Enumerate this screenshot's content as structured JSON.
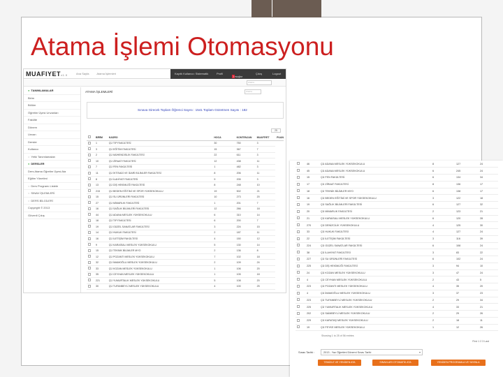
{
  "slide": {
    "title": "Atama İşlemi Otomasyonu"
  },
  "colors": {
    "title": "#cc1f1f",
    "accent_bar": "#6b5c52",
    "button": "#e8701b",
    "stats_text": "#2e3fb8"
  },
  "app": {
    "logo": "MUAFIYET",
    "logo_sub": "v1.0",
    "top_nav": [
      "Ana Sayfa",
      "Atama İşlemleri"
    ],
    "user_bar": [
      "Kayıtlı Kullanıcı: Sistematik",
      "Profil",
      "Mesajlar",
      "Çıkış",
      "Logout"
    ],
    "message_count": "3",
    "search_placeholder": "Arama"
  },
  "sidebar": {
    "items": [
      {
        "label": "TANIMLAMALAR",
        "type": "head"
      },
      {
        "label": "Birim",
        "type": "item"
      },
      {
        "label": "Bölüm",
        "type": "item"
      },
      {
        "label": "Öğretim Üyesi Unvanları",
        "type": "item"
      },
      {
        "label": "Fakülte",
        "type": "item"
      },
      {
        "label": "Dönem",
        "type": "item"
      },
      {
        "label": "Unvan",
        "type": "item"
      },
      {
        "label": "Dersler",
        "type": "item"
      },
      {
        "label": "Kullanıcı",
        "type": "item"
      },
      {
        "label": "Yetki Tanımlamaları",
        "type": "sub"
      },
      {
        "label": "DERSLER",
        "type": "head"
      },
      {
        "label": "Ders Atama Öğretim Üyesi Ata",
        "type": "item"
      },
      {
        "label": "Eğitim Yönetimi",
        "type": "item"
      },
      {
        "label": "Ders Programı Listele",
        "type": "sub"
      },
      {
        "label": "SINAV İŞLEMLERİ",
        "type": "sub"
      },
      {
        "label": "DERS BİLGİLERİ",
        "type": "sub"
      },
      {
        "label": "Copyright © 2013",
        "type": "item"
      },
      {
        "label": "Güvenli Çıkış",
        "type": "item"
      }
    ]
  },
  "panel": {
    "title": "ATAMA İŞLEMLERİ",
    "search_placeholder": "Arama",
    "stats": "Sınava Girecek Toplam Öğrenci Sayısı : 1541   Toplam Gözetmen Sayısı : 182",
    "per_page": "25"
  },
  "table1": {
    "headers": [
      "",
      "BİRİM",
      "KADRO",
      "HOCA",
      "KONTENJAN",
      "MUAFİYET",
      "PUAN"
    ],
    "rows": [
      [
        "1",
        "ÇÜ TIP FAKÜLTESİ",
        "30",
        "750",
        "3"
      ],
      [
        "3",
        "ÇÜ EĞİTİM FAKÜLTESİ",
        "15",
        "367",
        "7"
      ],
      [
        "2",
        "ÇÜ MÜHENDİSLİK FAKÜLTESİ",
        "22",
        "611",
        "3"
      ],
      [
        "10",
        "ÇÜ ZİRAAT FAKÜLTESİ",
        "12",
        "438",
        "11"
      ],
      [
        "7",
        "ÇÜ FEN FAKÜLTESİ",
        "1",
        "482",
        "3"
      ],
      [
        "11",
        "ÇÜ İKTİSADİ VE İDARİ BİLİMLER FAKÜLTESİ",
        "8",
        "206",
        "11"
      ],
      [
        "8",
        "ÇÜ İLAHİYAT FAKÜLTESİ",
        "9",
        "205",
        "3"
      ],
      [
        "13",
        "ÇÜ DİŞ HEKİMLİĞİ FAKÜLTESİ",
        "8",
        "248",
        "10"
      ],
      [
        "215",
        "ÇÜ BEDEN EĞİTİMİ VE SPOR YÜKSEKOKULU",
        "19",
        "502",
        "21"
      ],
      [
        "15",
        "ÇÜ SU ÜRÜNLERİ FAKÜLTESİ",
        "10",
        "273",
        "20"
      ],
      [
        "27",
        "ÇÜ MİMARLIK FAKÜLTESİ",
        "1",
        "201",
        "7"
      ],
      [
        "16",
        "ÇÜ SAĞLIK BİLİMLERİ FAKÜLTESİ",
        "12",
        "266",
        "18"
      ],
      [
        "44",
        "ÇÜ ADANA MESLEK YÜKSEKOKULU",
        "6",
        "310",
        "14"
      ],
      [
        "18",
        "ÇÜ TIP FAKÜLTESİ",
        "6",
        "200",
        "7"
      ],
      [
        "19",
        "ÇÜ GÜZEL SANATLAR FAKÜLTESİ",
        "3",
        "224",
        "15"
      ],
      [
        "14",
        "ÇÜ HUKUK FAKÜLTESİ",
        "2",
        "187",
        "11"
      ],
      [
        "16",
        "ÇÜ İLETİŞİM FAKÜLTESİ",
        "4",
        "150",
        "12"
      ],
      [
        "9",
        "ÇÜ KARAİSALI MESLEK YÜKSEKOKULU",
        "5",
        "130",
        "14"
      ],
      [
        "15",
        "ÇÜ TEKNİK BİLİMLER MYO",
        "2",
        "136",
        "8"
      ],
      [
        "12",
        "ÇÜ POZANTI MESLEK YÜKSEKOKULU",
        "7",
        "102",
        "18"
      ],
      [
        "32",
        "ÇÜ İMAMOĞLU MESLEK YÜKSEKOKULU",
        "2",
        "109",
        "24"
      ],
      [
        "33",
        "ÇÜ KOZAN MESLEK YÜKSEKOKULU",
        "1",
        "106",
        "20"
      ],
      [
        "35",
        "ÇÜ CEYHAN MESLEK YÜKSEKOKULU",
        "1",
        "105",
        "18"
      ],
      [
        "221",
        "ÇÜ YUMURTALIK MESLEK YÜKSEKOKULU",
        "5",
        "108",
        "20"
      ],
      [
        "30",
        "ÇÜ TUFANBEYLİ MESLEK YÜKSEKOKULU",
        "4",
        "100",
        "25"
      ]
    ]
  },
  "table2": {
    "rows": [
      [
        "46",
        "ÇÜ ADANA MESLEK YÜKSEKOKULU",
        "8",
        "127",
        "24"
      ],
      [
        "45",
        "ÇÜ ADANA MESLEK YÜKSEKOKULU",
        "6",
        "245",
        "24"
      ],
      [
        "15",
        "ÇÜ FEN FAKÜLTESİ",
        "6",
        "134",
        "34"
      ],
      [
        "17",
        "ÇÜ ZİRAAT FAKÜLTESİ",
        "8",
        "136",
        "17"
      ],
      [
        "18",
        "ÇÜ TEKNİK BİLİMLER MYO",
        "6",
        "138",
        "17"
      ],
      [
        "16",
        "ÇÜ BEDEN EĞİTİMİ VE SPOR YÜKSEKOKULU",
        "3",
        "122",
        "18"
      ],
      [
        "19",
        "ÇÜ SAĞLIK BİLİMLERİ FAKÜLTESİ",
        "6",
        "127",
        "32"
      ],
      [
        "20",
        "ÇÜ MİMARLIK FAKÜLTESİ",
        "2",
        "123",
        "21"
      ],
      [
        "21",
        "ÇÜ KARAİSALI MESLEK YÜKSEKOKULU",
        "6",
        "120",
        "28"
      ],
      [
        "270",
        "ÇÜ DENİZCİLİK YÜKSEKOKULU",
        "4",
        "125",
        "30"
      ],
      [
        "33",
        "ÇÜ HUKUK FAKÜLTESİ",
        "4",
        "127",
        "24"
      ],
      [
        "22",
        "ÇÜ İLETİŞİM FAKÜLTESİ",
        "3",
        "116",
        "39"
      ],
      [
        "224",
        "ÇÜ GÜZEL SANATLAR FAKÜLTESİ",
        "6",
        "108",
        "24"
      ],
      [
        "38",
        "ÇÜ İLAHİYAT FAKÜLTESİ",
        "3",
        "83",
        "22"
      ],
      [
        "227",
        "ÇÜ SU ÜRÜNLERİ FAKÜLTESİ",
        "6",
        "102",
        "24"
      ],
      [
        "225",
        "ÇÜ DİŞ HEKİMLİĞİ FAKÜLTESİ",
        "3",
        "94",
        "10"
      ],
      [
        "24",
        "ÇÜ KOZAN MESLEK YÜKSEKOKULU",
        "3",
        "47",
        "24"
      ],
      [
        "4",
        "ÇÜ CEYHAN MESLEK YÜKSEKOKULU",
        "2",
        "43",
        "5"
      ],
      [
        "223",
        "ÇÜ POZANTI MESLEK YÜKSEKOKULU",
        "4",
        "35",
        "20"
      ],
      [
        "4",
        "ÇÜ İMAMOĞLU MESLEK YÜKSEKOKULU",
        "3",
        "37",
        "23"
      ],
      [
        "223",
        "ÇÜ TUFANBEYLİ MESLEK YÜKSEKOKULU",
        "2",
        "29",
        "34"
      ],
      [
        "225",
        "ÇÜ YUMURTALIK MESLEK YÜKSEKOKULU",
        "4",
        "33",
        "21"
      ],
      [
        "202",
        "ÇÜ SAİMBEYLİ MESLEK YÜKSEKOKULU",
        "2",
        "29",
        "26"
      ],
      [
        "229",
        "ÇÜ KARATAŞ MESLEK YÜKSEKOKULU",
        "2",
        "18",
        "11"
      ],
      [
        "19",
        "ÇÜ FEYKE MESLEK YÜKSEKOKULU",
        "1",
        "12",
        "26"
      ]
    ],
    "showing": "Showing 1 to 25 of 56 entries",
    "pager": "First  1  2  3  Last"
  },
  "form": {
    "label": "Sınav Tarihi :",
    "select_value": "2013 - Yaz Öğretimi Dönemi Sınav Tarihi",
    "buttons": [
      "TEMİZLE VE YENİDEN ATA",
      "SINAVLARI OTOMATİK ATA",
      "YENİDEN PROGRAMLA VE YAYINLA"
    ]
  }
}
